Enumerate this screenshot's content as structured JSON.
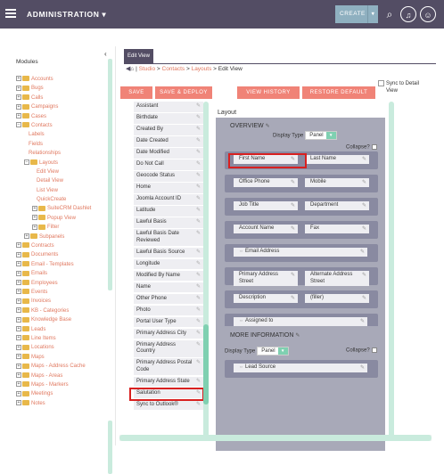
{
  "topbar": {
    "title": "ADMINISTRATION",
    "create_label": "CREATE"
  },
  "sidebar": {
    "title": "Modules",
    "collapse": "‹",
    "tree": [
      {
        "label": "Accounts",
        "indent": 0,
        "pm": "+",
        "folder": true
      },
      {
        "label": "Bugs",
        "indent": 0,
        "pm": "+",
        "folder": true
      },
      {
        "label": "Calls",
        "indent": 0,
        "pm": "+",
        "folder": true
      },
      {
        "label": "Campaigns",
        "indent": 0,
        "pm": "+",
        "folder": true
      },
      {
        "label": "Cases",
        "indent": 0,
        "pm": "+",
        "folder": true
      },
      {
        "label": "Contacts",
        "indent": 0,
        "pm": "−",
        "folder": true
      },
      {
        "label": "Labels",
        "indent": 1,
        "pm": "",
        "folder": false
      },
      {
        "label": "Fields",
        "indent": 1,
        "pm": "",
        "folder": false
      },
      {
        "label": "Relationships",
        "indent": 1,
        "pm": "",
        "folder": false
      },
      {
        "label": "Layouts",
        "indent": 1,
        "pm": "−",
        "folder": true
      },
      {
        "label": "Edit View",
        "indent": 2,
        "pm": "",
        "folder": false
      },
      {
        "label": "Detail View",
        "indent": 2,
        "pm": "",
        "folder": false
      },
      {
        "label": "List View",
        "indent": 2,
        "pm": "",
        "folder": false
      },
      {
        "label": "QuickCreate",
        "indent": 2,
        "pm": "",
        "folder": false
      },
      {
        "label": "SuiteCRM Dashlet",
        "indent": 2,
        "pm": "+",
        "folder": true
      },
      {
        "label": "Popup View",
        "indent": 2,
        "pm": "+",
        "folder": true
      },
      {
        "label": "Filter",
        "indent": 2,
        "pm": "+",
        "folder": true
      },
      {
        "label": "Subpanels",
        "indent": 1,
        "pm": "+",
        "folder": true
      },
      {
        "label": "Contracts",
        "indent": 0,
        "pm": "+",
        "folder": true
      },
      {
        "label": "Documents",
        "indent": 0,
        "pm": "+",
        "folder": true
      },
      {
        "label": "Email - Templates",
        "indent": 0,
        "pm": "+",
        "folder": true
      },
      {
        "label": "Emails",
        "indent": 0,
        "pm": "+",
        "folder": true
      },
      {
        "label": "Employees",
        "indent": 0,
        "pm": "+",
        "folder": true
      },
      {
        "label": "Events",
        "indent": 0,
        "pm": "+",
        "folder": true
      },
      {
        "label": "Invoices",
        "indent": 0,
        "pm": "+",
        "folder": true
      },
      {
        "label": "KB - Categories",
        "indent": 0,
        "pm": "+",
        "folder": true
      },
      {
        "label": "Knowledge Base",
        "indent": 0,
        "pm": "+",
        "folder": true
      },
      {
        "label": "Leads",
        "indent": 0,
        "pm": "+",
        "folder": true
      },
      {
        "label": "Line Items",
        "indent": 0,
        "pm": "+",
        "folder": true
      },
      {
        "label": "Locations",
        "indent": 0,
        "pm": "+",
        "folder": true
      },
      {
        "label": "Maps",
        "indent": 0,
        "pm": "+",
        "folder": true
      },
      {
        "label": "Maps - Address Cache",
        "indent": 0,
        "pm": "+",
        "folder": true
      },
      {
        "label": "Maps - Areas",
        "indent": 0,
        "pm": "+",
        "folder": true
      },
      {
        "label": "Maps - Markers",
        "indent": 0,
        "pm": "+",
        "folder": true
      },
      {
        "label": "Meetings",
        "indent": 0,
        "pm": "+",
        "folder": true
      },
      {
        "label": "Notes",
        "indent": 0,
        "pm": "+",
        "folder": true
      }
    ]
  },
  "main": {
    "tab": "Edit View",
    "crumb": {
      "studio": "Studio",
      "contacts": "Contacts",
      "layouts": "Layouts",
      "current": "Edit View",
      "sep": ">"
    },
    "sync_label": "Sync to Detail View",
    "buttons": {
      "save": "SAVE",
      "save_deploy": "SAVE & DEPLOY",
      "view_history": "VIEW HISTORY",
      "restore": "RESTORE DEFAULT"
    },
    "fields": [
      "Assistant",
      "Birthdate",
      "Created By",
      "Date Created",
      "Date Modified",
      "Do Not Call",
      "Geocode Status",
      "Home",
      "Joomla Account ID",
      "Latitude",
      "Lawful Basis",
      "Lawful Basis Date Reviewed",
      "Lawful Basis Source",
      "Longitude",
      "Modified By Name",
      "Name",
      "Other Phone",
      "Photo",
      "Portal User Type",
      "Primary Address City",
      "Primary Address Country",
      "Primary Address Postal Code",
      "Primary Address State",
      "Salutation",
      "Sync to Outlook®"
    ],
    "layout_title": "Layout",
    "panel1": {
      "title": "OVERVIEW",
      "display_type_label": "Display Type",
      "display_type": "Panel",
      "collapse_label": "Collapse?",
      "rows": [
        [
          "First Name",
          "Last Name"
        ],
        [
          "Office Phone",
          "Mobile"
        ],
        [
          "Job Title",
          "Department"
        ],
        [
          "Account Name",
          "Fax"
        ],
        [
          "Email Address"
        ],
        [
          "Primary Address Street",
          "Alternate Address Street"
        ],
        [
          "Description",
          "(filler)"
        ],
        [
          "Assigned to"
        ]
      ]
    },
    "panel2": {
      "title": "MORE INFORMATION",
      "display_type_label": "Display Type",
      "display_type": "Panel",
      "collapse_label": "Collapse?",
      "rows": [
        [
          "Lead Source"
        ]
      ]
    }
  }
}
